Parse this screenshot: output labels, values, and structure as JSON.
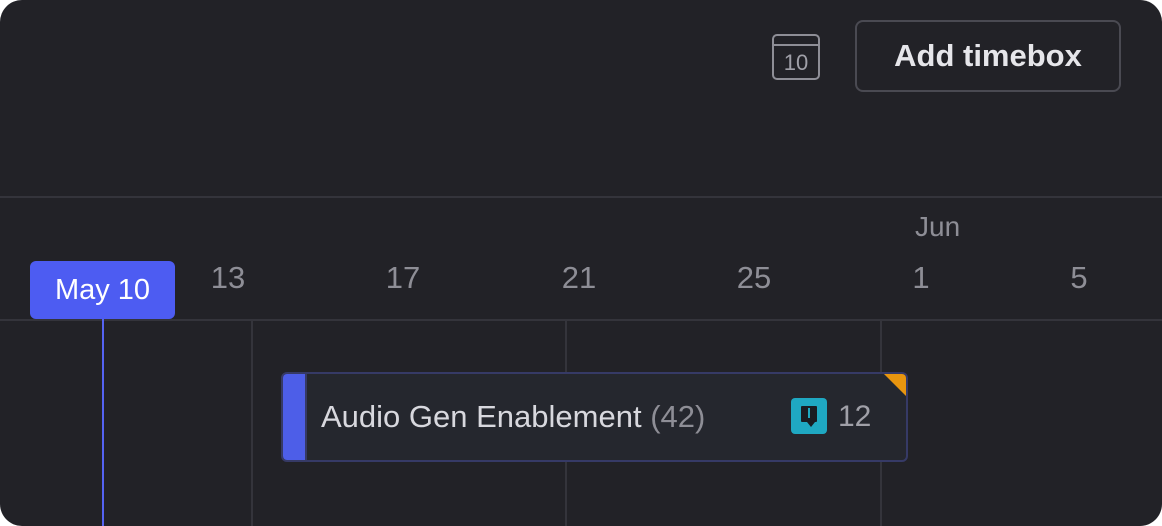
{
  "toolbar": {
    "calendar_day": "10",
    "add_timebox_label": "Add timebox"
  },
  "timeline": {
    "month_label": "Jun",
    "today_label": "May 10",
    "ticks": [
      "13",
      "17",
      "21",
      "25",
      "1",
      "5"
    ]
  },
  "timebox": {
    "name": "Audio Gen Enablement",
    "count": "(42)",
    "issue_count": "12"
  },
  "colors": {
    "background": "#222227",
    "accent": "#4d5cf2",
    "issue_icon": "#1fa8c2",
    "corner_flag": "#e8950f"
  }
}
